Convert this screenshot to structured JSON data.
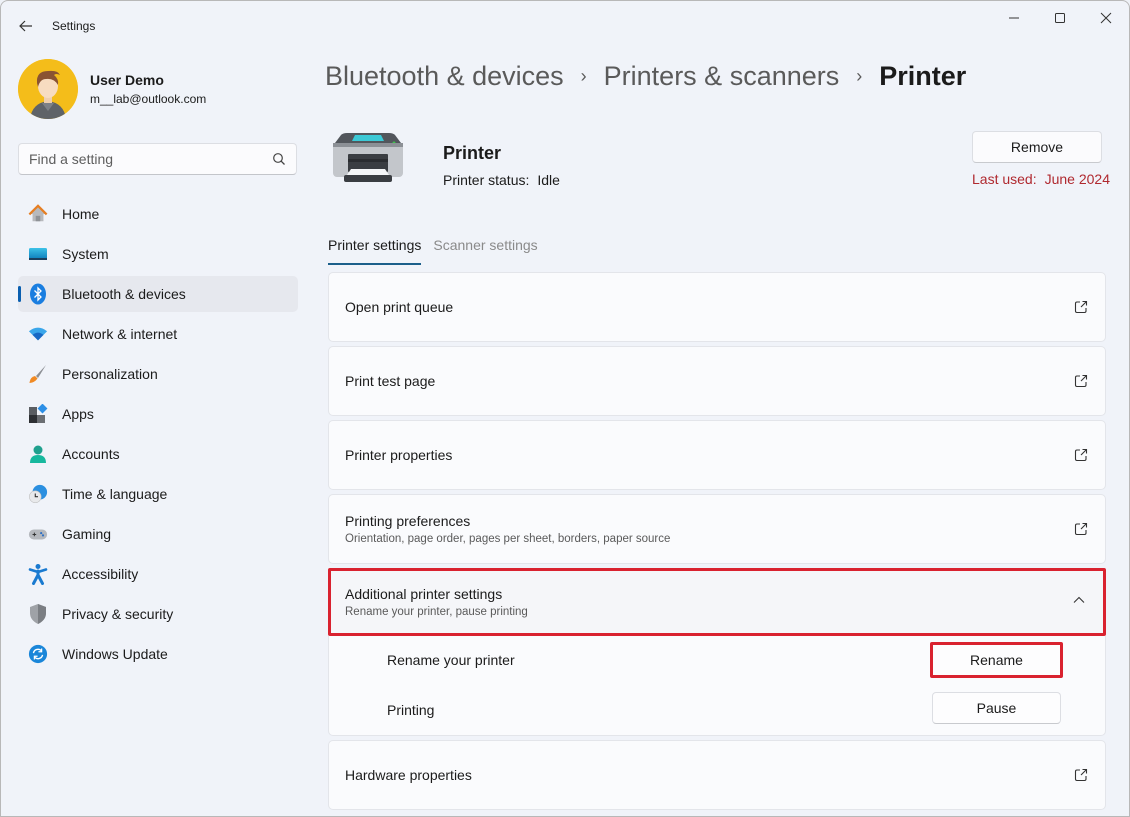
{
  "window": {
    "app_title": "Settings",
    "controls": {
      "minimize": "minimize-icon",
      "maximize": "maximize-icon",
      "close": "close-icon"
    }
  },
  "profile": {
    "name": "User Demo",
    "email": "m__lab@outlook.com"
  },
  "search": {
    "placeholder": "Find a setting",
    "value": ""
  },
  "sidebar": {
    "active_index": 2,
    "items": [
      {
        "label": "Home",
        "icon": "home-icon"
      },
      {
        "label": "System",
        "icon": "system-icon"
      },
      {
        "label": "Bluetooth & devices",
        "icon": "bluetooth-icon"
      },
      {
        "label": "Network & internet",
        "icon": "wifi-icon"
      },
      {
        "label": "Personalization",
        "icon": "brush-icon"
      },
      {
        "label": "Apps",
        "icon": "apps-icon"
      },
      {
        "label": "Accounts",
        "icon": "accounts-icon"
      },
      {
        "label": "Time & language",
        "icon": "time-language-icon"
      },
      {
        "label": "Gaming",
        "icon": "gamepad-icon"
      },
      {
        "label": "Accessibility",
        "icon": "accessibility-icon"
      },
      {
        "label": "Privacy & security",
        "icon": "shield-icon"
      },
      {
        "label": "Windows Update",
        "icon": "update-icon"
      }
    ]
  },
  "breadcrumb": {
    "items": [
      "Bluetooth & devices",
      "Printers & scanners"
    ],
    "current": "Printer",
    "separator": "›"
  },
  "device": {
    "name": "Printer",
    "status_label": "Printer status:",
    "status_value": "Idle",
    "remove_label": "Remove",
    "last_used_label": "Last used:",
    "last_used_value": "June 2024",
    "last_used_color": "#b0292f"
  },
  "tabs": [
    {
      "label": "Printer settings",
      "active": true
    },
    {
      "label": "Scanner settings",
      "active": false
    }
  ],
  "settings": {
    "open_print_queue": {
      "title": "Open print queue"
    },
    "print_test_page": {
      "title": "Print test page"
    },
    "printer_properties": {
      "title": "Printer properties"
    },
    "printing_preferences": {
      "title": "Printing preferences",
      "subtitle": "Orientation, page order, pages per sheet, borders, paper source"
    },
    "additional": {
      "title": "Additional printer settings",
      "subtitle": "Rename your printer, pause printing",
      "expanded": true,
      "rename_label": "Rename your printer",
      "rename_button": "Rename",
      "printing_label": "Printing",
      "pause_button": "Pause"
    },
    "hardware_properties": {
      "title": "Hardware properties"
    }
  },
  "highlight_color": "#d9222f"
}
